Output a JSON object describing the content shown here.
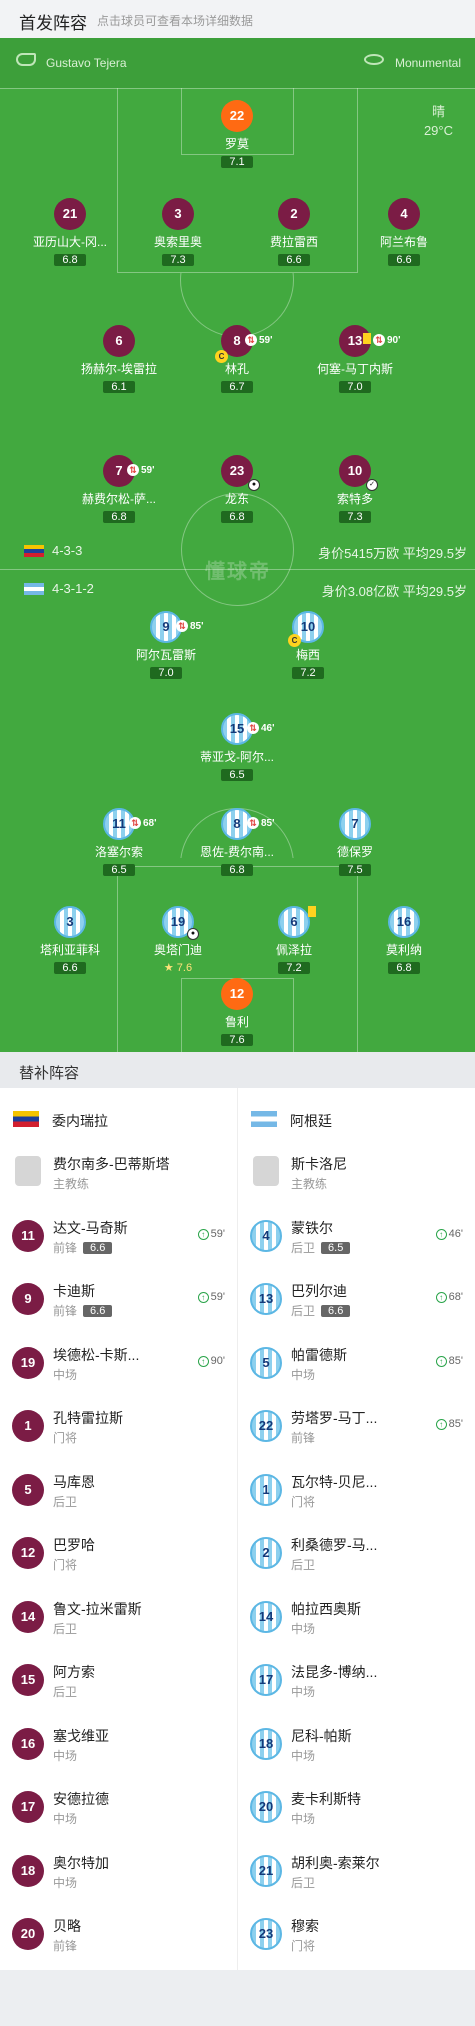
{
  "header": {
    "title": "首发阵容",
    "hint": "点击球员可查看本场详细数据"
  },
  "pitch": {
    "referee": "Gustavo Tejera",
    "stadium": "Monumental",
    "weather": "晴",
    "temp": "29°C",
    "watermark": "懂球帝",
    "home_formation": "4-3-3",
    "home_value": "身价5415万欧  平均29.5岁",
    "away_formation": "4-3-1-2",
    "away_value": "身价3.08亿欧  平均29.5岁"
  },
  "home_players": [
    {
      "num": "22",
      "name": "罗莫",
      "rating": "7.1",
      "gk": true
    },
    {
      "num": "21",
      "name": "亚历山大-冈...",
      "rating": "6.8"
    },
    {
      "num": "3",
      "name": "奥索里奥",
      "rating": "7.3"
    },
    {
      "num": "2",
      "name": "费拉雷西",
      "rating": "6.6"
    },
    {
      "num": "4",
      "name": "阿兰布鲁",
      "rating": "6.6"
    },
    {
      "num": "6",
      "name": "扬赫尔-埃雷拉",
      "rating": "6.1"
    },
    {
      "num": "8",
      "name": "林孔",
      "rating": "6.7",
      "sub": "59'",
      "cap": true
    },
    {
      "num": "13",
      "name": "何塞-马丁内斯",
      "rating": "7.0",
      "sub": "90'",
      "yc": true
    },
    {
      "num": "7",
      "name": "赫费尔松-萨...",
      "rating": "6.8",
      "sub": "59'"
    },
    {
      "num": "23",
      "name": "龙东",
      "rating": "6.8",
      "goal": true
    },
    {
      "num": "10",
      "name": "索特多",
      "rating": "7.3",
      "assist": true
    }
  ],
  "away_players": [
    {
      "num": "9",
      "name": "阿尔瓦雷斯",
      "rating": "7.0",
      "sub": "85'"
    },
    {
      "num": "10",
      "name": "梅西",
      "rating": "7.2",
      "cap": true
    },
    {
      "num": "15",
      "name": "蒂亚戈-阿尔...",
      "rating": "6.5",
      "sub": "46'"
    },
    {
      "num": "11",
      "name": "洛塞尔索",
      "rating": "6.5",
      "sub": "68'"
    },
    {
      "num": "8",
      "name": "恩佐-费尔南...",
      "rating": "6.8",
      "sub": "85'"
    },
    {
      "num": "7",
      "name": "德保罗",
      "rating": "7.5"
    },
    {
      "num": "3",
      "name": "塔利亚菲科",
      "rating": "6.6"
    },
    {
      "num": "19",
      "name": "奥塔门迪",
      "rating": "7.6",
      "goal": true,
      "star": true
    },
    {
      "num": "6",
      "name": "佩泽拉",
      "rating": "7.2",
      "yc": true
    },
    {
      "num": "16",
      "name": "莫利纳",
      "rating": "6.8"
    },
    {
      "num": "12",
      "name": "鲁利",
      "rating": "7.6",
      "gk": true
    }
  ],
  "subs": {
    "title": "替补阵容",
    "home": {
      "team": "委内瑞拉",
      "list": [
        {
          "num": "",
          "name": "费尔南多-巴蒂斯塔",
          "pos": "主教练",
          "coach": true
        },
        {
          "num": "11",
          "name": "达文-马奇斯",
          "pos": "前锋",
          "rating": "6.6",
          "time": "59'"
        },
        {
          "num": "9",
          "name": "卡迪斯",
          "pos": "前锋",
          "rating": "6.6",
          "time": "59'"
        },
        {
          "num": "19",
          "name": "埃德松-卡斯...",
          "pos": "中场",
          "time": "90'"
        },
        {
          "num": "1",
          "name": "孔特雷拉斯",
          "pos": "门将"
        },
        {
          "num": "5",
          "name": "马库恩",
          "pos": "后卫"
        },
        {
          "num": "12",
          "name": "巴罗哈",
          "pos": "门将"
        },
        {
          "num": "14",
          "name": "鲁文-拉米雷斯",
          "pos": "后卫"
        },
        {
          "num": "15",
          "name": "阿方索",
          "pos": "后卫"
        },
        {
          "num": "16",
          "name": "塞戈维亚",
          "pos": "中场"
        },
        {
          "num": "17",
          "name": "安德拉德",
          "pos": "中场"
        },
        {
          "num": "18",
          "name": "奥尔特加",
          "pos": "中场"
        },
        {
          "num": "20",
          "name": "贝略",
          "pos": "前锋"
        }
      ]
    },
    "away": {
      "team": "阿根廷",
      "list": [
        {
          "num": "",
          "name": "斯卡洛尼",
          "pos": "主教练",
          "coach": true
        },
        {
          "num": "4",
          "name": "蒙铁尔",
          "pos": "后卫",
          "rating": "6.5",
          "time": "46'"
        },
        {
          "num": "13",
          "name": "巴列尔迪",
          "pos": "后卫",
          "rating": "6.6",
          "time": "68'"
        },
        {
          "num": "5",
          "name": "帕雷德斯",
          "pos": "中场",
          "time": "85'"
        },
        {
          "num": "22",
          "name": "劳塔罗-马丁...",
          "pos": "前锋",
          "time": "85'"
        },
        {
          "num": "1",
          "name": "瓦尔特-贝尼...",
          "pos": "门将"
        },
        {
          "num": "2",
          "name": "利桑德罗-马...",
          "pos": "后卫"
        },
        {
          "num": "14",
          "name": "帕拉西奥斯",
          "pos": "中场"
        },
        {
          "num": "17",
          "name": "法昆多-博纳...",
          "pos": "中场"
        },
        {
          "num": "18",
          "name": "尼科-帕斯",
          "pos": "中场"
        },
        {
          "num": "20",
          "name": "麦卡利斯特",
          "pos": "中场"
        },
        {
          "num": "21",
          "name": "胡利奥-索莱尔",
          "pos": "后卫"
        },
        {
          "num": "23",
          "name": "穆索",
          "pos": "门将"
        }
      ]
    }
  }
}
